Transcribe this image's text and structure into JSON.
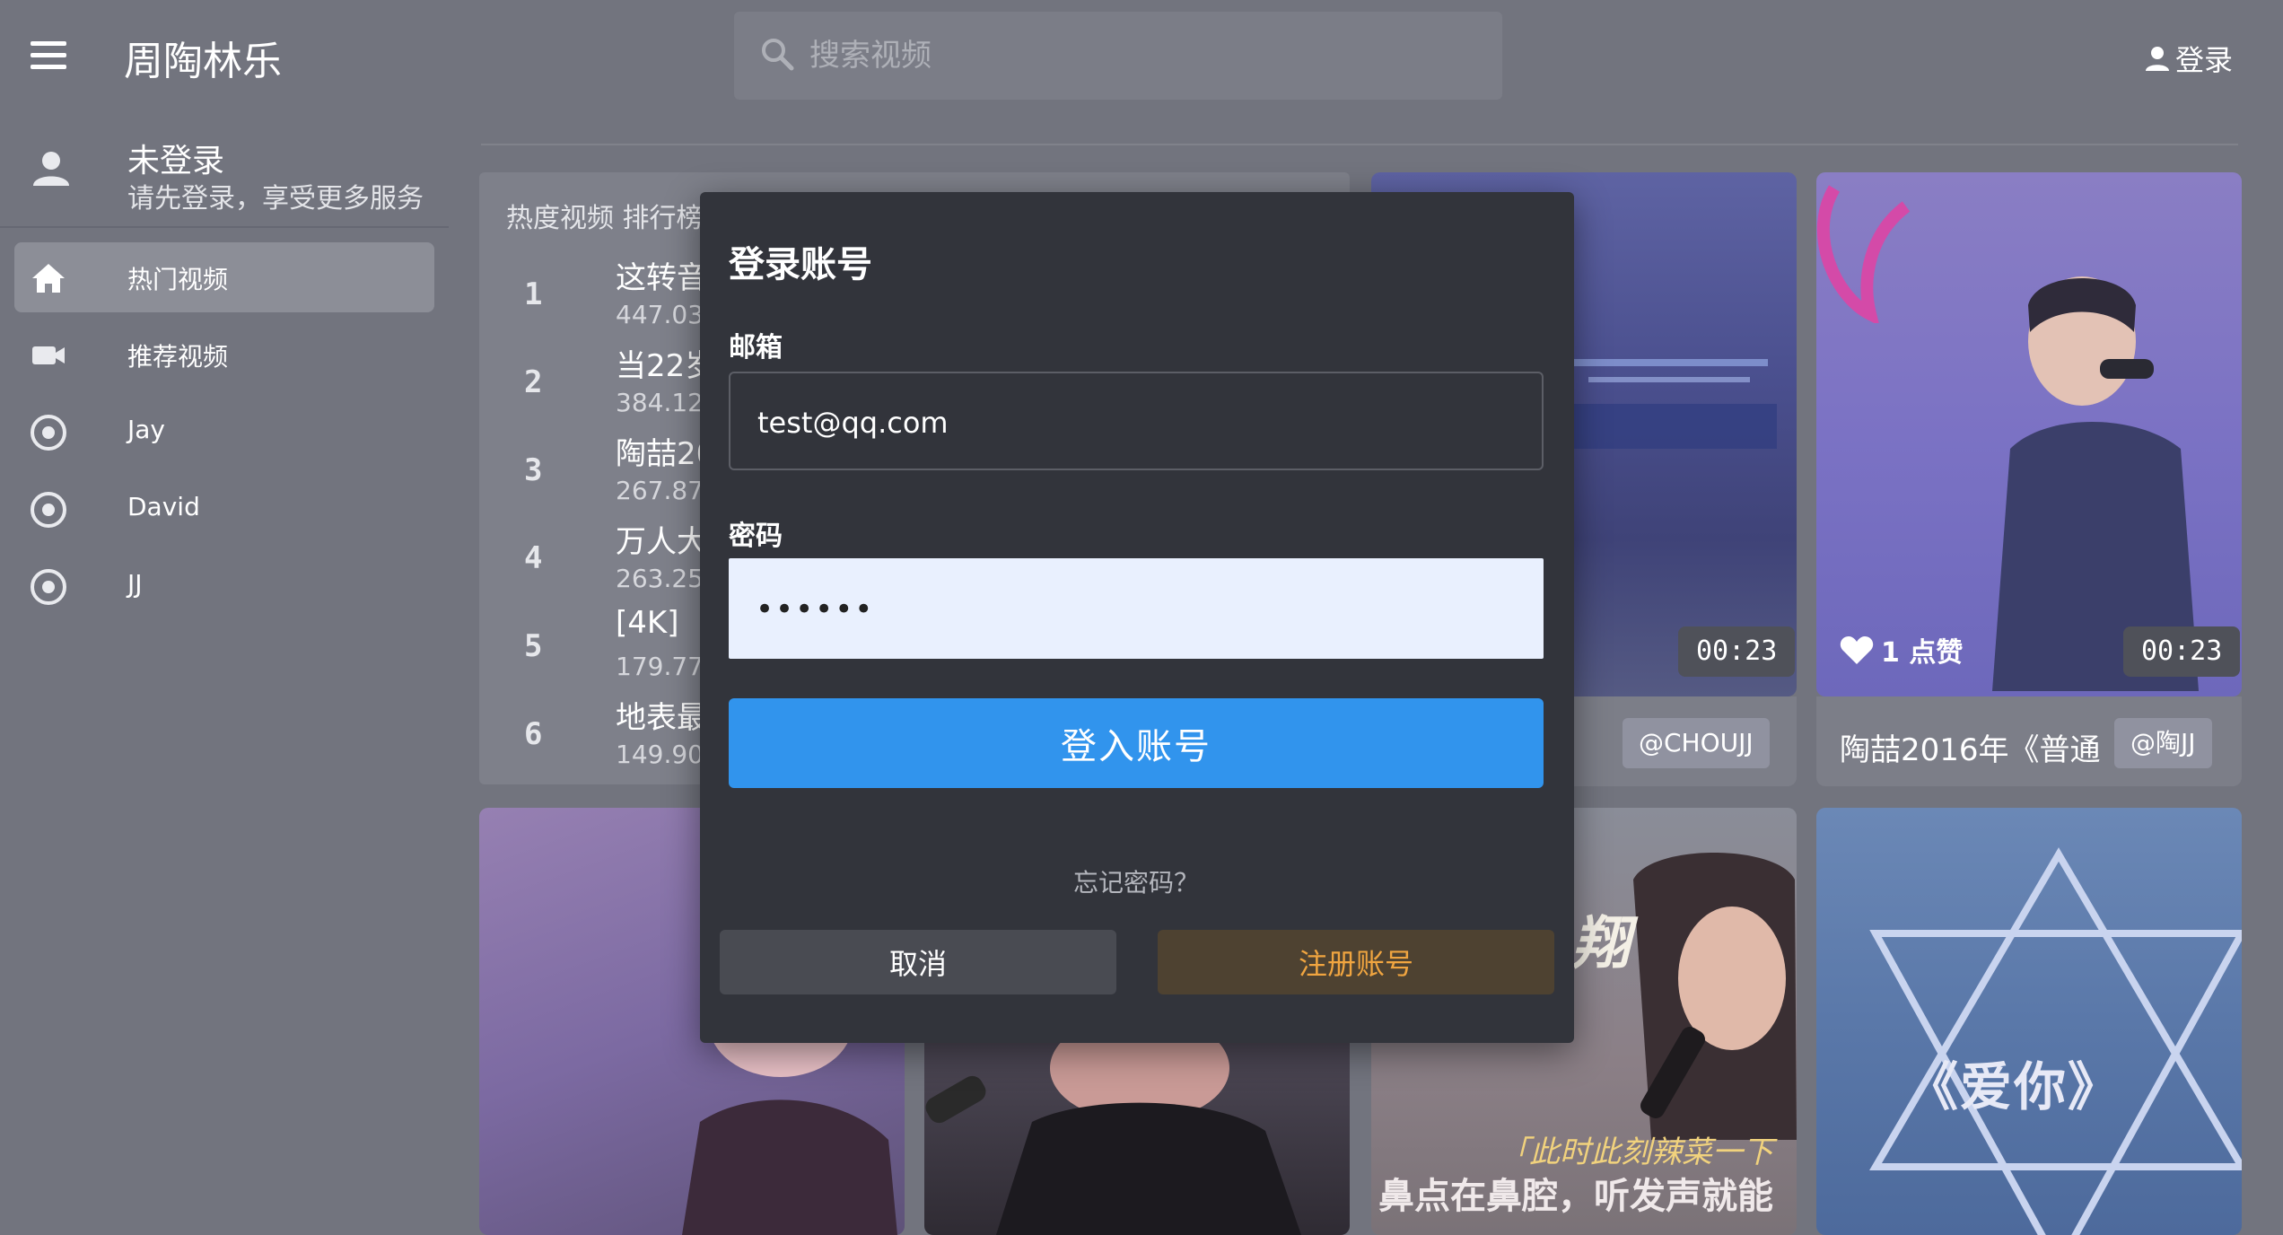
{
  "header": {
    "brand": "周陶林乐",
    "search_placeholder": "搜索视频",
    "login_label": "登录"
  },
  "sidebar": {
    "user_name": "未登录",
    "user_subtitle": "请先登录，享受更多服务",
    "items": [
      {
        "label": "热门视频",
        "icon": "home-icon",
        "active": true
      },
      {
        "label": "推荐视频",
        "icon": "video-camera-icon",
        "active": false
      },
      {
        "label": "Jay",
        "icon": "radio-icon",
        "active": false
      },
      {
        "label": "David",
        "icon": "radio-icon",
        "active": false
      },
      {
        "label": "JJ",
        "icon": "radio-icon",
        "active": false
      }
    ]
  },
  "ranking": {
    "title": "热度视频 排行榜",
    "rows": [
      {
        "rank": "1",
        "title": "这转音",
        "count": "447.03"
      },
      {
        "rank": "2",
        "title": "当22岁",
        "count": "384.12"
      },
      {
        "rank": "3",
        "title": "陶喆20",
        "count": "267.87"
      },
      {
        "rank": "4",
        "title": "万人大",
        "count": "263.25"
      },
      {
        "rank": "5",
        "title": " [4K]",
        "count": "179.77"
      },
      {
        "rank": "6",
        "title": "地表最",
        "count": "149.90"
      }
    ]
  },
  "cards": {
    "a": {
      "duration": "00:23",
      "tag": "@CHOUJJ"
    },
    "b": {
      "likes": "1 点赞",
      "duration": "00:23",
      "title": "陶喆2016年《普通",
      "tag": "@陶JJ"
    },
    "e": {
      "overlay_text": "鼻点在鼻腔，听发声就能",
      "quote": "「此时此刻辣菜一下",
      "sign": "翔"
    },
    "f": {
      "overlay_text": "《爱你》"
    }
  },
  "dialog": {
    "title": "登录账号",
    "email_label": "邮箱",
    "email_value": "test@qq.com",
    "password_label": "密码",
    "password_value": "••••••",
    "login_button": "登入账号",
    "forgot_link": "忘记密码？",
    "cancel_button": "取消",
    "register_button": "注册账号"
  },
  "colors": {
    "accent_blue": "#3194ed",
    "register_orange": "#f0a540",
    "dialog_bg": "#32343b",
    "overlay_bg": "#72747e"
  }
}
